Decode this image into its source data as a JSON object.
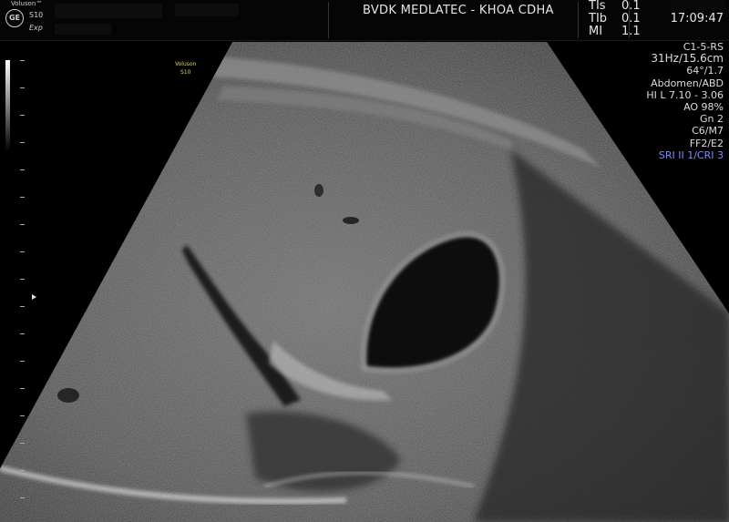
{
  "header": {
    "brand": "Voluson™",
    "logo": "GE",
    "model": "S10",
    "mode": "Exp",
    "institution": "BVDK MEDLATEC - KHOA CDHA",
    "indices": [
      {
        "label": "TIs",
        "value": "0.1"
      },
      {
        "label": "TIb",
        "value": "0.1"
      },
      {
        "label": "MI",
        "value": "1.1"
      }
    ],
    "time": "17:09:47"
  },
  "params": {
    "probe": "C1-5-RS",
    "frame_depth": "31Hz/15.6cm",
    "angle": "64°/1.7",
    "preset": "Abdomen/ABD",
    "hi": "HI L  7.10 - 3.06",
    "ao": "AO 98%",
    "gain": "Gn  2",
    "map": "C6/M7",
    "ff": "FF2/E2",
    "sri": "SRI II 1/CRI 3"
  },
  "image_mark": {
    "line1": "Voluson",
    "line2": "S10"
  },
  "colors": {
    "background": "#000000",
    "sri": "#7c8cff",
    "image_mark": "#d9d35a"
  },
  "icons": [
    "ge-logo-icon",
    "focus-marker-icon"
  ]
}
